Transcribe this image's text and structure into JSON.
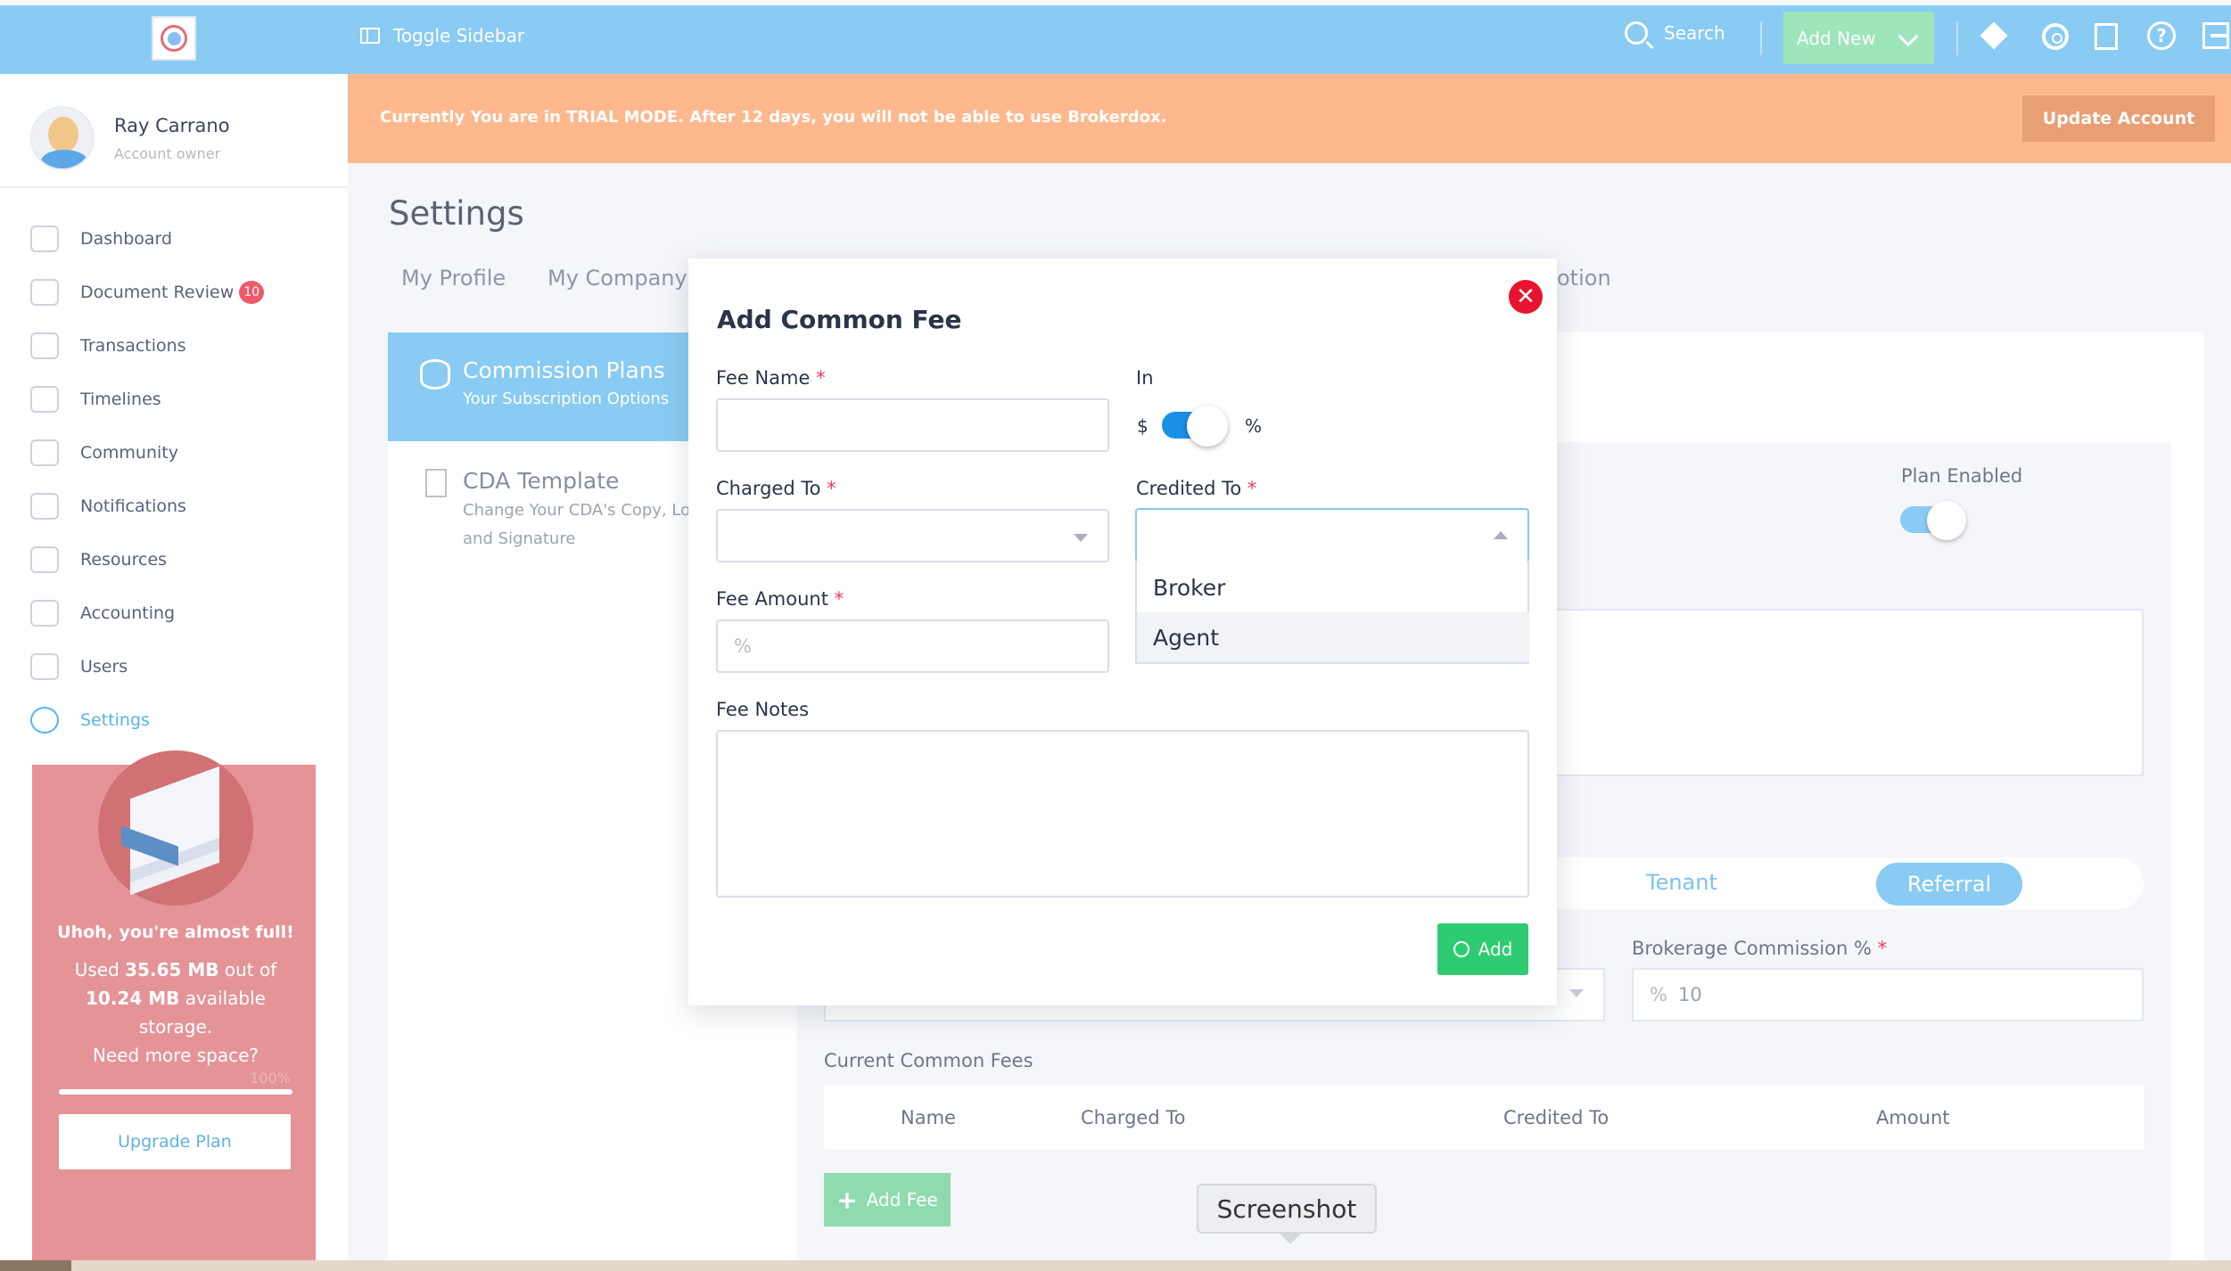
{
  "topbar": {
    "toggle_label": "Toggle Sidebar",
    "search_label": "Search",
    "add_new_label": "Add New"
  },
  "user": {
    "name": "Ray Carrano",
    "role": "Account owner"
  },
  "nav": [
    {
      "label": "Dashboard",
      "icon": "speedometer-icon"
    },
    {
      "label": "Document Review",
      "icon": "document-icon",
      "badge": "10"
    },
    {
      "label": "Transactions",
      "icon": "dollar-icon"
    },
    {
      "label": "Timelines",
      "icon": "timeline-icon"
    },
    {
      "label": "Community",
      "icon": "people-icon"
    },
    {
      "label": "Notifications",
      "icon": "chat-icon"
    },
    {
      "label": "Resources",
      "icon": "folder-icon"
    },
    {
      "label": "Accounting",
      "icon": "calculator-icon"
    },
    {
      "label": "Users",
      "icon": "user-icon"
    },
    {
      "label": "Settings",
      "icon": "gear-icon",
      "active": true
    }
  ],
  "storage": {
    "title": "Uhoh, you're almost full!",
    "line1_pre": "Used ",
    "used": "35.65 MB",
    "line1_post": " out of",
    "available": "10.24 MB",
    "line2_post": " available",
    "line3": "storage.",
    "line4": "Need more space?",
    "percent": "100%",
    "upgrade_label": "Upgrade Plan"
  },
  "trial": {
    "message": "Currently You are in TRIAL MODE. After 12 days, you will not be able to use Brokerdox.",
    "update_label": "Update Account"
  },
  "page": {
    "title": "Settings",
    "tabs": [
      "My Profile",
      "My Company",
      "otion"
    ]
  },
  "submenu": [
    {
      "title": "Commission Plans",
      "subtitle": "Your Subscription Options"
    },
    {
      "title": "CDA Template",
      "subtitle": "Change Your CDA's Copy, Lo",
      "subtitle2": "and Signature"
    }
  ],
  "background": {
    "plan_enabled": "Plan Enabled",
    "tenant": "Tenant",
    "referral": "Referral",
    "brokerage_label": "Brokerage Commission %",
    "brokerage_prefix": "%",
    "brokerage_value": "10",
    "current_fees": "Current Common Fees",
    "columns": [
      "Name",
      "Charged To",
      "Credited To",
      "Amount"
    ],
    "add_fee": "Add Fee"
  },
  "modal": {
    "title": "Add Common Fee",
    "fee_name": "Fee Name",
    "in": "In",
    "currency": "$",
    "percent": "%",
    "charged_to": "Charged To",
    "credited_to": "Credited To",
    "fee_amount": "Fee Amount",
    "fee_amount_placeholder": "%",
    "fee_notes": "Fee Notes",
    "options": [
      "Broker",
      "Agent"
    ],
    "add": "Add",
    "required": "*"
  },
  "tooltip": "Screenshot",
  "colors": {
    "topbar": "#89cbf2",
    "trial": "#ffb88d",
    "accent": "#58b3ea",
    "add_button": "#2ecc71",
    "close": "#e8132f"
  }
}
